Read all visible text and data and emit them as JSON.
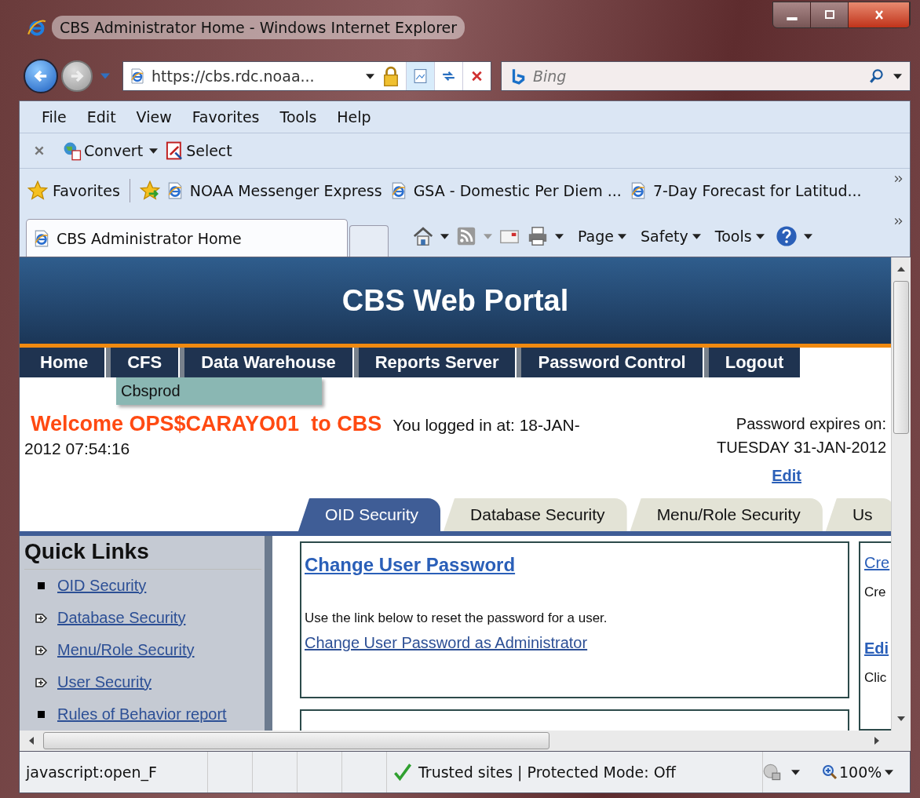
{
  "window": {
    "title": "CBS Administrator Home - Windows Internet Explorer"
  },
  "address_bar": {
    "url": "https://cbs.rdc.noaa..."
  },
  "search": {
    "placeholder": "Bing"
  },
  "menu_bar": [
    "File",
    "Edit",
    "View",
    "Favorites",
    "Tools",
    "Help"
  ],
  "command_bar": [
    {
      "label": "Convert",
      "has_dropdown": true
    },
    {
      "label": "Select",
      "has_dropdown": false
    }
  ],
  "favorites_bar": {
    "label": "Favorites",
    "links": [
      "NOAA Messenger Express",
      "GSA - Domestic Per Diem ...",
      "7-Day Forecast for Latitud..."
    ]
  },
  "tabs": [
    {
      "label": "CBS Administrator Home",
      "selected": true
    }
  ],
  "tab_tools": [
    "Page",
    "Safety",
    "Tools"
  ],
  "portal": {
    "title": "CBS Web Portal",
    "nav": [
      "Home",
      "CFS",
      "Data Warehouse",
      "Reports Server",
      "Password Control",
      "Logout"
    ],
    "nav_dropdown": {
      "items": [
        "Cbsprod"
      ]
    },
    "welcome": "Welcome OPS$CARAYO01  to CBS",
    "login_info": [
      "You logged in at: 18-JAN-",
      "2012 07:54:16"
    ],
    "password_expiry": {
      "label": "Password expires on:",
      "date": "TUESDAY 31-JAN-2012",
      "edit_link": "Edit"
    },
    "section_tabs": [
      {
        "label": "OID Security",
        "selected": true
      },
      {
        "label": "Database Security",
        "selected": false
      },
      {
        "label": "Menu/Role Security",
        "selected": false
      },
      {
        "label": "Us",
        "selected": false
      }
    ],
    "quick_links": {
      "title": "Quick Links",
      "items": [
        {
          "label": "OID Security",
          "kind": "leaf"
        },
        {
          "label": "Database Security",
          "kind": "expandable"
        },
        {
          "label": "Menu/Role Security",
          "kind": "expandable"
        },
        {
          "label": "User Security",
          "kind": "expandable"
        },
        {
          "label": "Rules of Behavior report",
          "kind": "leaf"
        }
      ]
    },
    "main_panel": {
      "title": "Change User Password",
      "text": "Use the link below to reset the password for a user.",
      "link": "Change User Password as Administrator"
    },
    "side_panel": [
      {
        "kind": "link",
        "text": "Cre"
      },
      {
        "kind": "text",
        "text": "Cre"
      },
      {
        "kind": "link",
        "text": "Edi"
      },
      {
        "kind": "text",
        "text": "Clic"
      }
    ]
  },
  "status_bar": {
    "url": "javascript:open_F",
    "zone": "Trusted sites | Protected Mode: Off",
    "zoom": "100%"
  }
}
